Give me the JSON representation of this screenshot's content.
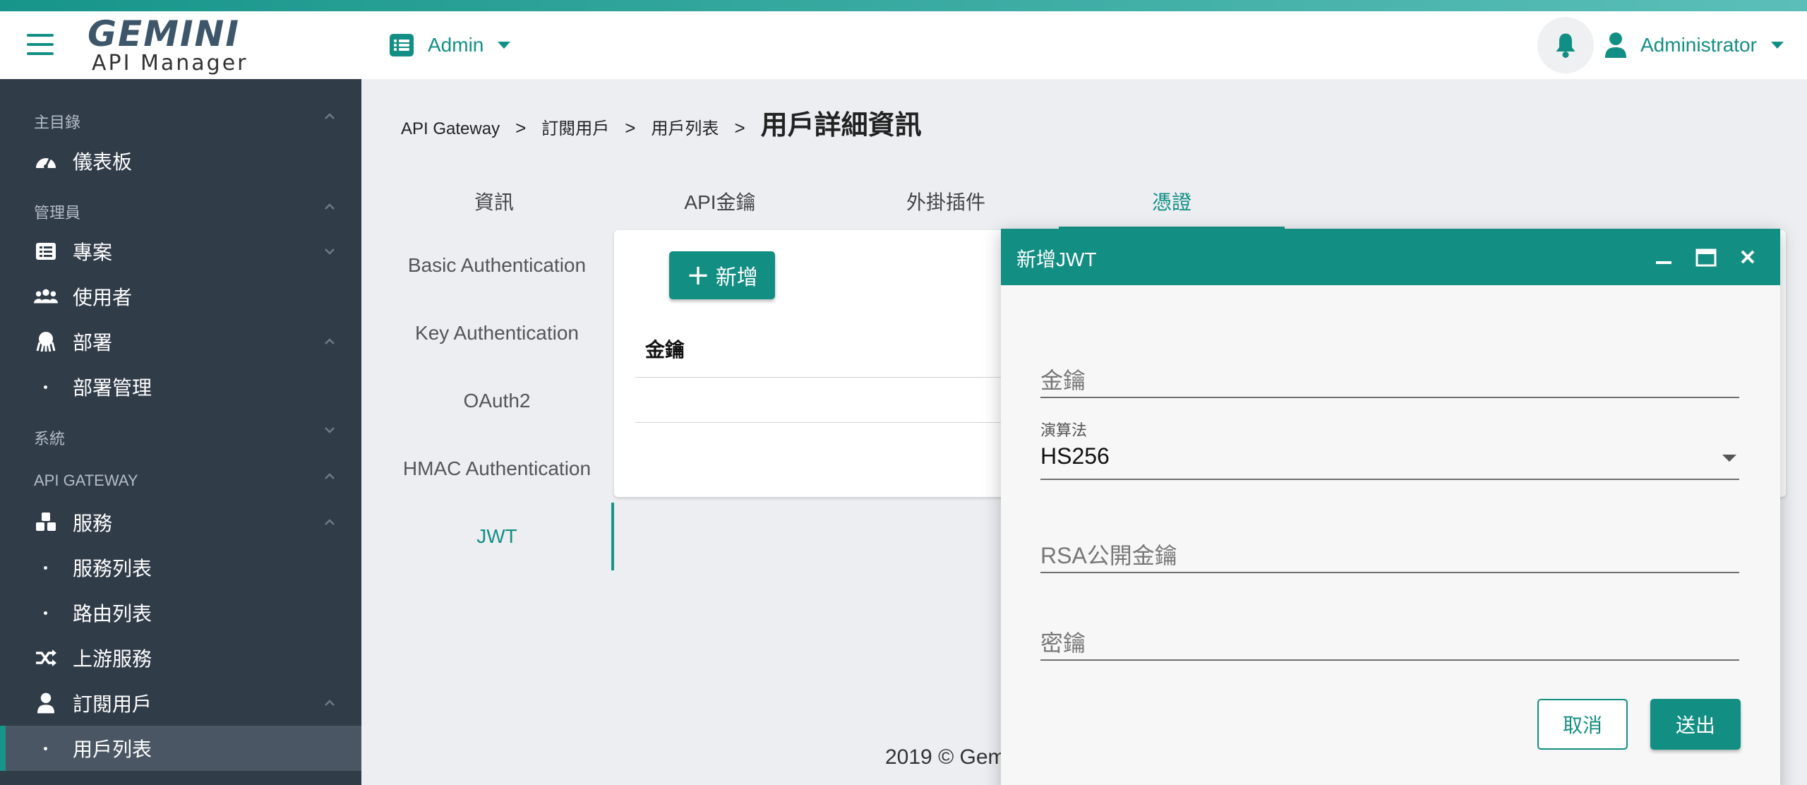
{
  "app": {
    "logo_main": "GEMINI",
    "logo_sub": "API Manager"
  },
  "header": {
    "org_label": "Admin",
    "user_label": "Administrator"
  },
  "sidebar": {
    "sections": {
      "main": "主目錄",
      "admin": "管理員",
      "system": "系統",
      "gateway": "API GATEWAY"
    },
    "items": {
      "dashboard": "儀表板",
      "projects": "專案",
      "users": "使用者",
      "deploy": "部署",
      "deploy_manage": "部署管理",
      "services": "服務",
      "service_list": "服務列表",
      "route_list": "路由列表",
      "upstream": "上游服務",
      "consumers": "訂閱用戶",
      "consumer_list": "用戶列表"
    }
  },
  "breadcrumb": {
    "items": [
      "API Gateway",
      "訂閱用戶",
      "用戶列表"
    ],
    "separator": ">",
    "current": "用戶詳細資訊"
  },
  "tabs": [
    "資訊",
    "API金鑰",
    "外掛插件",
    "憑證"
  ],
  "active_tab": "憑證",
  "auth_tabs": [
    "Basic Authentication",
    "Key Authentication",
    "OAuth2",
    "HMAC Authentication",
    "JWT"
  ],
  "active_auth_tab": "JWT",
  "card": {
    "add_label": "新增",
    "column_key": "金鑰"
  },
  "footer": {
    "text": "2019 © Gem"
  },
  "dialog": {
    "title": "新增JWT",
    "key_placeholder": "金鑰",
    "algorithm_label": "演算法",
    "algorithm_value": "HS256",
    "rsa_placeholder": "RSA公開金鑰",
    "secret_placeholder": "密鑰",
    "cancel_label": "取消",
    "submit_label": "送出"
  },
  "colors": {
    "accent": "#138e83",
    "sidebar_bg": "#313c49",
    "page_bg": "#eceef2"
  }
}
